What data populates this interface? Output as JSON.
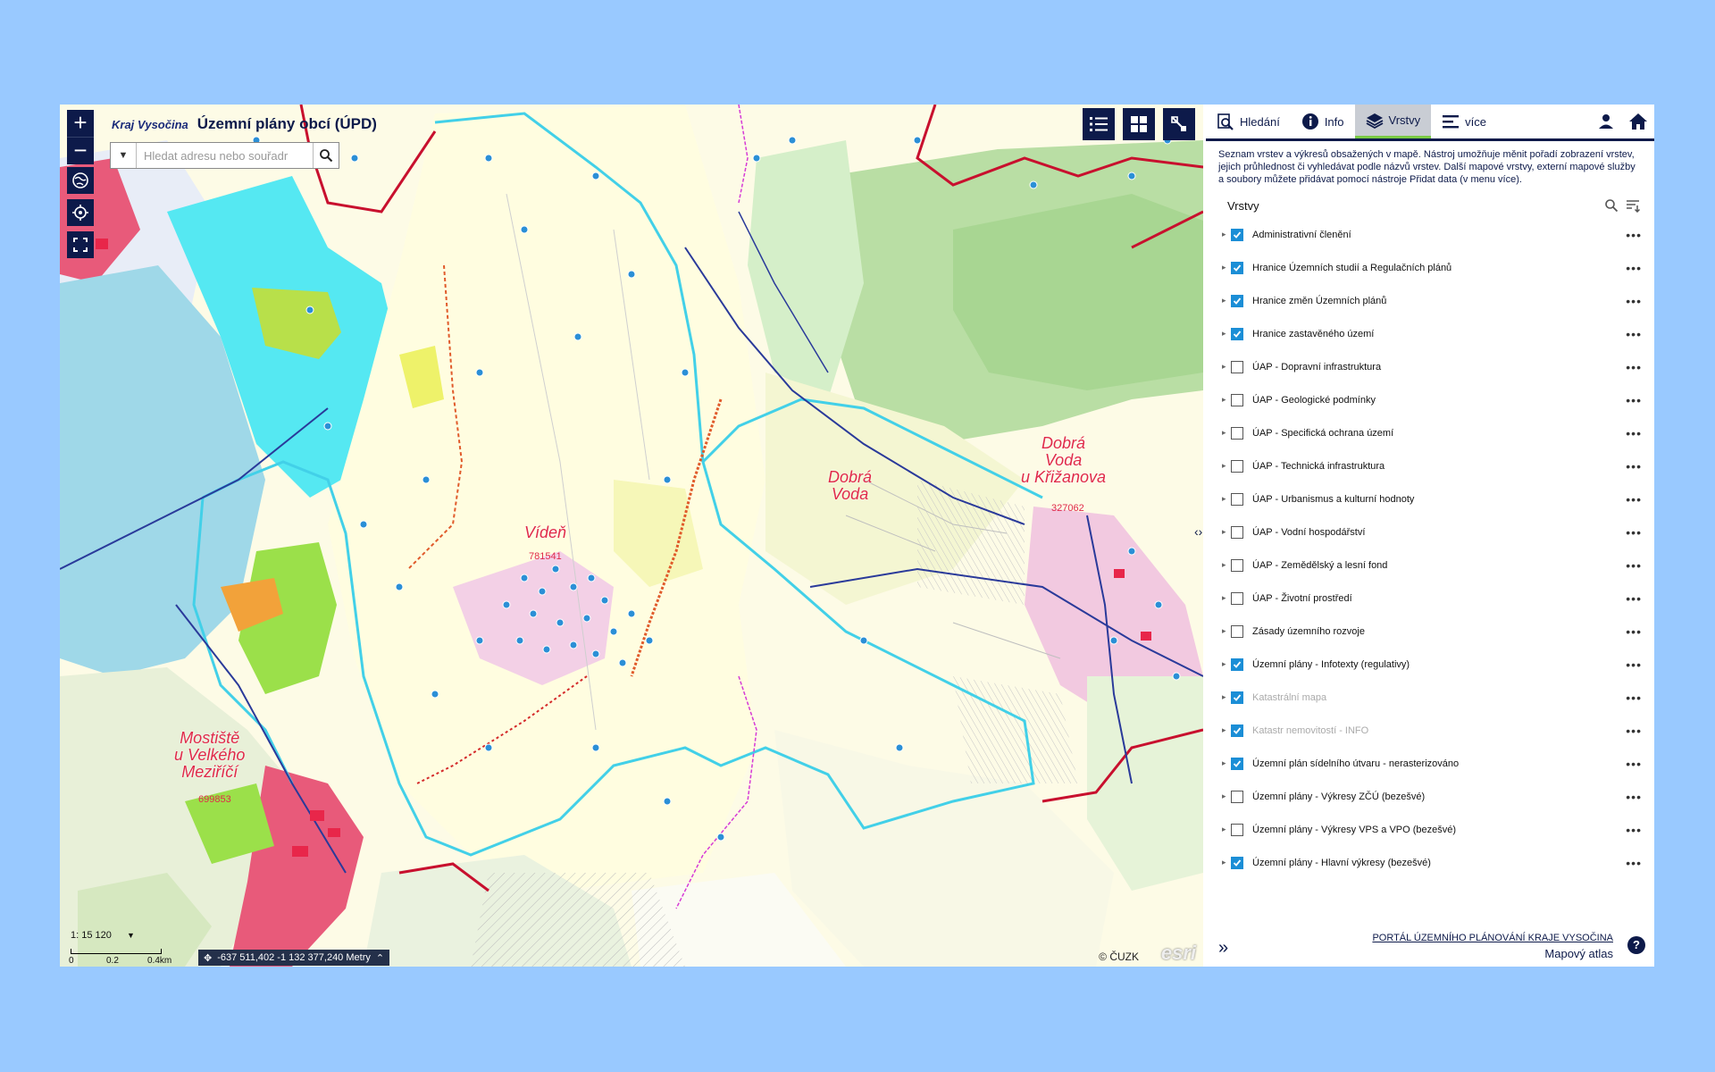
{
  "header": {
    "logo_text": "Kraj Vysočina",
    "app_title": "Územní plány obcí (ÚPD)"
  },
  "search": {
    "placeholder": "Hledat adresu nebo souřadr"
  },
  "map": {
    "places": [
      {
        "name_lines": [
          "Vídeň"
        ],
        "code": "781541"
      },
      {
        "name_lines": [
          "Dobrá",
          "Voda"
        ],
        "code": ""
      },
      {
        "name_lines": [
          "Dobrá",
          "Voda",
          "u Křižanova"
        ],
        "code": "327062"
      },
      {
        "name_lines": [
          "Mostiště",
          "u Velkého",
          "Meziříčí"
        ],
        "code": "699853"
      }
    ],
    "scale": "1: 15 120",
    "scale_ticks": [
      "0",
      "0.2",
      "0.4km"
    ],
    "coordinates": "-637 511,402 -1 132 377,240 Metry",
    "copyright": "© ČUZK",
    "esri": "esri"
  },
  "tabs": [
    {
      "label": "Hledání",
      "icon": "search-doc-icon",
      "active": false
    },
    {
      "label": "Info",
      "icon": "info-icon",
      "active": false
    },
    {
      "label": "Vrstvy",
      "icon": "layers-icon",
      "active": true
    },
    {
      "label": "více",
      "icon": "menu-icon",
      "active": false
    }
  ],
  "panel": {
    "description": "Seznam vrstev a výkresů obsažených v mapě. Nástroj umožňuje měnit pořadí zobrazení vrstev, jejich průhlednost či vyhledávat podle názvů vrstev. Další mapové vrstvy, externí mapové služby a soubory můžete přidávat pomocí nástroje Přidat data (v menu více).",
    "layers_title": "Vrstvy",
    "footer_link": "PORTÁL ÚZEMNÍHO PLÁNOVÁNÍ KRAJE VYSOČINA",
    "footer_app": "Mapový atlas",
    "help": "?"
  },
  "layers": [
    {
      "label": "Administrativní členění",
      "checked": true,
      "dim": false
    },
    {
      "label": "Hranice Územních studií a Regulačních plánů",
      "checked": true,
      "dim": false
    },
    {
      "label": "Hranice změn Územních plánů",
      "checked": true,
      "dim": false
    },
    {
      "label": "Hranice zastavěného území",
      "checked": true,
      "dim": false
    },
    {
      "label": "ÚAP - Dopravní infrastruktura",
      "checked": false,
      "dim": false
    },
    {
      "label": "ÚAP - Geologické podmínky",
      "checked": false,
      "dim": false
    },
    {
      "label": "ÚAP - Specifická ochrana území",
      "checked": false,
      "dim": false
    },
    {
      "label": "ÚAP - Technická infrastruktura",
      "checked": false,
      "dim": false
    },
    {
      "label": "ÚAP - Urbanismus a kulturní hodnoty",
      "checked": false,
      "dim": false
    },
    {
      "label": "ÚAP - Vodní hospodářství",
      "checked": false,
      "dim": false
    },
    {
      "label": "ÚAP - Zemědělský a lesní fond",
      "checked": false,
      "dim": false
    },
    {
      "label": "ÚAP - Životní prostředí",
      "checked": false,
      "dim": false
    },
    {
      "label": "Zásady územního rozvoje",
      "checked": false,
      "dim": false
    },
    {
      "label": "Územní plány - Infotexty (regulativy)",
      "checked": true,
      "dim": false
    },
    {
      "label": "Katastrální mapa",
      "checked": true,
      "dim": true
    },
    {
      "label": "Katastr nemovitostí - INFO",
      "checked": true,
      "dim": true
    },
    {
      "label": "Územní plán sídelního útvaru - nerasterizováno",
      "checked": true,
      "dim": false
    },
    {
      "label": "Územní plány - Výkresy ZČÚ (bezešvé)",
      "checked": false,
      "dim": false
    },
    {
      "label": "Územní plány - Výkresy VPS a VPO (bezešvé)",
      "checked": false,
      "dim": false
    },
    {
      "label": "Územní plány - Hlavní výkresy (bezešvé)",
      "checked": true,
      "dim": false
    }
  ],
  "colors": {
    "navy": "#0d1a4a",
    "accent_green": "#7acb45",
    "checkbox_blue": "#1b8ed6",
    "place_label": "#e02a4a",
    "background": "#99c9ff"
  }
}
